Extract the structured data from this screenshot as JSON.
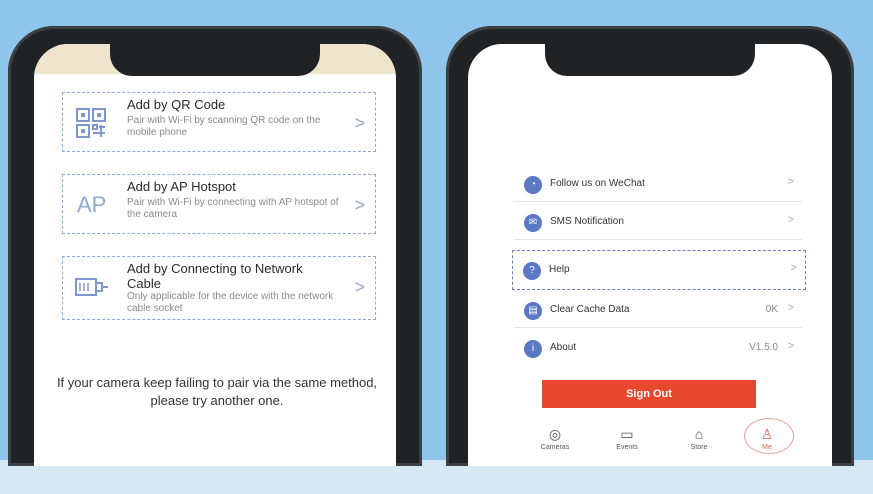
{
  "left_screen": {
    "options": [
      {
        "title": "Add by QR Code",
        "desc": "Pair with Wi-Fi by scanning QR code on the mobile phone",
        "icon": "qr-code-icon"
      },
      {
        "title": "Add by AP Hotspot",
        "desc": "Pair with Wi-Fi by connecting with AP hotspot of the camera",
        "icon": "ap-hotspot-icon",
        "icon_text": "AP"
      },
      {
        "title": "Add by Connecting to Network Cable",
        "desc": "Only applicable for the device with the network cable socket",
        "icon": "network-cable-icon"
      }
    ],
    "chevron": ">",
    "hint": "If your camera keep failing to pair via the same method, please try another one."
  },
  "right_screen": {
    "menu": [
      {
        "label": "Follow us on WeChat",
        "value": "",
        "icon": "wechat-icon"
      },
      {
        "label": "SMS Notification",
        "value": "",
        "icon": "sms-icon"
      },
      {
        "label": "Help",
        "value": "",
        "icon": "help-icon"
      },
      {
        "label": "Clear Cache Data",
        "value": "0K",
        "icon": "clear-cache-icon"
      },
      {
        "label": "About",
        "value": "V1.5.0",
        "icon": "about-icon"
      }
    ],
    "chevron": ">",
    "sign_out": "Sign Out",
    "tabs": [
      {
        "label": "Cameras",
        "icon": "camera-icon"
      },
      {
        "label": "Events",
        "icon": "events-icon"
      },
      {
        "label": "Store",
        "icon": "store-icon"
      },
      {
        "label": "Me",
        "icon": "me-icon",
        "active": true
      }
    ]
  },
  "colors": {
    "accent": "#e8492e",
    "blue_icon": "#5b78c4",
    "background": "#8ec5ea"
  }
}
